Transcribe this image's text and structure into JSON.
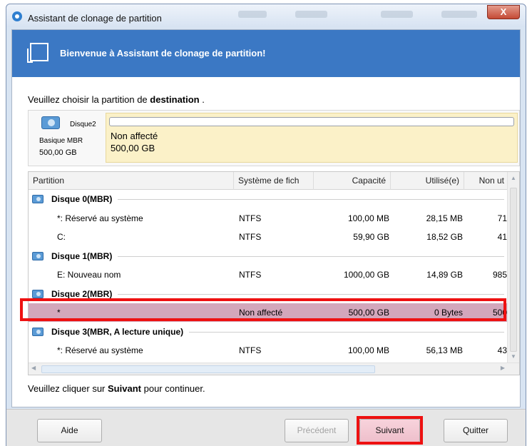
{
  "window": {
    "title": "Assistant de clonage de partition",
    "close_label": "X"
  },
  "banner": {
    "title": "Bienvenue à Assistant de clonage de partition!"
  },
  "instruction": {
    "prefix": "Veuillez choisir la partition de",
    "bold": "destination",
    "suffix": "."
  },
  "disk_panel": {
    "name": "Disque2",
    "type": "Basique MBR",
    "size": "500,00 GB",
    "partition_label": "Non affecté",
    "partition_size": "500,00 GB"
  },
  "table": {
    "columns": [
      "Partition",
      "Système de fich",
      "Capacité",
      "Utilisé(e)",
      "Non ut"
    ],
    "rows": [
      {
        "kind": "group",
        "label": "Disque 0(MBR)"
      },
      {
        "kind": "item",
        "partition": "*: Réservé au système",
        "fs": "NTFS",
        "capacity": "100,00 MB",
        "used": "28,15 MB",
        "unused": "71"
      },
      {
        "kind": "item",
        "partition": "C:",
        "fs": "NTFS",
        "capacity": "59,90 GB",
        "used": "18,52 GB",
        "unused": "41"
      },
      {
        "kind": "group",
        "label": "Disque 1(MBR)"
      },
      {
        "kind": "item",
        "partition": "E: Nouveau nom",
        "fs": "NTFS",
        "capacity": "1000,00 GB",
        "used": "14,89 GB",
        "unused": "985"
      },
      {
        "kind": "group",
        "label": "Disque 2(MBR)"
      },
      {
        "kind": "item",
        "partition": "*",
        "fs": "Non affecté",
        "capacity": "500,00 GB",
        "used": "0 Bytes",
        "unused": "500",
        "selected": true
      },
      {
        "kind": "group",
        "label": "Disque 3(MBR, A lecture unique)"
      },
      {
        "kind": "item",
        "partition": "*: Réservé au système",
        "fs": "NTFS",
        "capacity": "100,00 MB",
        "used": "56,13 MB",
        "unused": "43"
      }
    ]
  },
  "continue_hint": {
    "prefix": "Veuillez cliquer sur",
    "bold": "Suivant",
    "suffix": "pour continuer."
  },
  "buttons": {
    "help": "Aide",
    "previous": "Précédent",
    "next": "Suivant",
    "quit": "Quitter"
  },
  "colors": {
    "banner": "#3b78c4",
    "selected_row": "#d3a7bb",
    "highlight": "#ee1111",
    "partition_bg": "#fbf1c8"
  }
}
